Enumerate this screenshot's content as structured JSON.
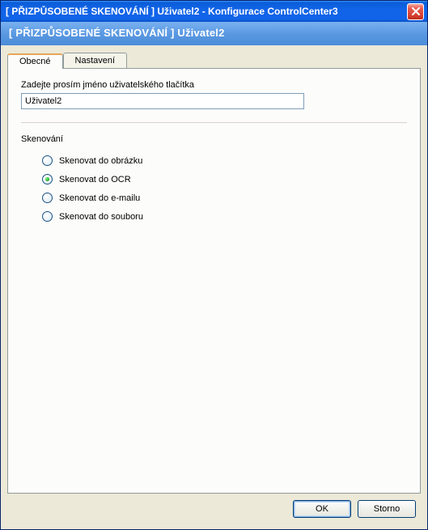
{
  "window": {
    "title": "[ PŘIZPŮSOBENÉ SKENOVÁNÍ ]  Uživatel2 - Konfigurace ControlCenter3"
  },
  "subheader": "[ PŘIZPŮSOBENÉ SKENOVÁNÍ ]   Uživatel2",
  "tabs": {
    "general": "Obecné",
    "settings": "Nastavení"
  },
  "form": {
    "name_prompt": "Zadejte prosím jméno uživatelského tlačítka",
    "name_value": "Uživatel2"
  },
  "scan": {
    "section_title": "Skenování",
    "selected": 1,
    "options": [
      "Skenovat do obrázku",
      "Skenovat do OCR",
      "Skenovat do e-mailu",
      "Skenovat do souboru"
    ]
  },
  "buttons": {
    "ok": "OK",
    "cancel": "Storno"
  }
}
